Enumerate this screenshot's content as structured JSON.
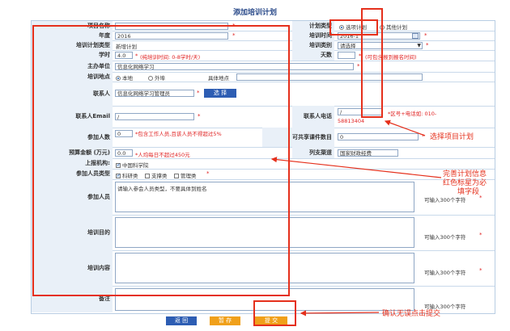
{
  "title": "添加培训计划",
  "fields": {
    "project_name": {
      "label": "项目名称",
      "value": ""
    },
    "plan_type": {
      "label": "计划类型",
      "option_selected": "选项计划",
      "option_other": "其他计划"
    },
    "year": {
      "label": "年度",
      "value": "2016"
    },
    "train_time": {
      "label": "培训时间",
      "value": "2016-1"
    },
    "plan_kind": {
      "label": "培训计划类型",
      "value": "新增计划"
    },
    "category": {
      "label": "培训类别",
      "value": "请选择"
    },
    "hours": {
      "label": "学时",
      "value": "4.0",
      "note": "(纯培训时间: 0-8学时/天)"
    },
    "days": {
      "label": "天数",
      "value": "",
      "note": "(可包含报到报名时间)"
    },
    "host": {
      "label": "主办单位",
      "value": "信息化网络学习"
    },
    "location": {
      "label": "培训地点",
      "local": "本地",
      "remote": "外埠",
      "detail_label": "具体地点",
      "detail_value": ""
    },
    "contact": {
      "label": "联系人",
      "value": "信息化网络学习管理员",
      "button": "选 择"
    },
    "email": {
      "label": "联系人Email",
      "value": "/"
    },
    "phone": {
      "label": "联系人电话",
      "value": "/",
      "value2": "58813404",
      "note": "*区号+电话如: 010-"
    },
    "attendees": {
      "label": "参加人数",
      "value": "0",
      "note": "*包含工作人员,且该人员不得超过5%"
    },
    "courseware": {
      "label": "可共享课件数目",
      "value": "0"
    },
    "budget": {
      "label": "预算金额 (万元)",
      "value": "0.0",
      "note": "*人均每日不超过450元"
    },
    "channel": {
      "label": "列支渠道",
      "value": "国家财政经费"
    },
    "org": {
      "label": "上报机构:",
      "value": "中国科学院"
    },
    "person_type": {
      "label": "参加人员类型",
      "opt1": "科研类",
      "opt2": "支撑类",
      "opt3": "管理类"
    },
    "participants": {
      "label": "参加人员",
      "placeholder": "请输入参会人员类型，不要具体到姓名",
      "counter": "可输入300个字符"
    },
    "purpose": {
      "label": "培训目的",
      "counter": "可输入300个字符"
    },
    "content": {
      "label": "培训内容",
      "counter": "可输入300个字符"
    },
    "remark": {
      "label": "备注",
      "counter": "可输入300个字符"
    }
  },
  "buttons": {
    "back": "返 回",
    "draft": "暂 存",
    "submit": "提 交"
  },
  "annotations": {
    "select_plan": "选择项目计划",
    "fill_info_1": "完善计划信息",
    "fill_info_2": "红色标星为必",
    "fill_info_3": "填字段",
    "confirm": "确认无误点击提交"
  },
  "required_mark": "*",
  "colors": {
    "label_bg": "#e9f0f8",
    "button_blue": "#2d5db3",
    "button_orange": "#f0a01a",
    "annotation_red": "#e5301c"
  }
}
